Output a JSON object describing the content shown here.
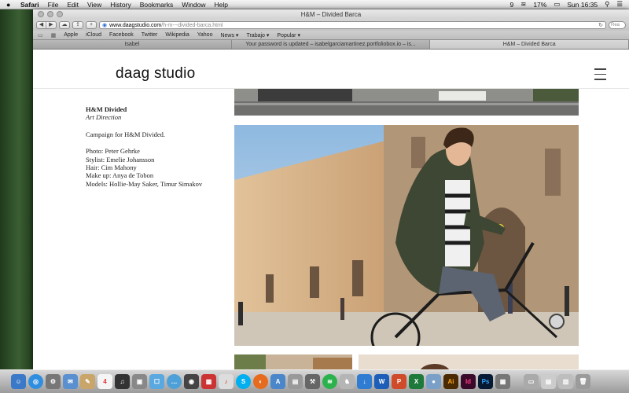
{
  "menubar": {
    "app_name": "Safari",
    "items": [
      "File",
      "Edit",
      "View",
      "History",
      "Bookmarks",
      "Window",
      "Help"
    ],
    "status": {
      "battery": "17%",
      "clock": "Sun 16:35",
      "badge": "9"
    }
  },
  "window": {
    "title": "H&M – Divided Barca",
    "address": {
      "domain": "www.daagstudio.com",
      "path": "/h-m---divided-barca.html"
    },
    "search_placeholder": "Rea",
    "bookmarks": [
      "Apple",
      "iCloud",
      "Facebook",
      "Twitter",
      "Wikipedia",
      "Yahoo",
      "News ▾",
      "Trabajo ▾",
      "Popular ▾"
    ],
    "tabs": [
      {
        "label": "Isabel"
      },
      {
        "label": "Your password is updated – isabelgarciamartinez.portfoliobox.io – is..."
      },
      {
        "label": "H&M – Divided Barca"
      }
    ]
  },
  "site": {
    "logo": "daag studio",
    "project": {
      "title": "H&M Divided",
      "subtitle": "Art Direction",
      "description": "Campaign for H&M Divided.",
      "credits": [
        "Photo: Peter Gehrke",
        "Stylist: Emelie Johansson",
        "Hair: Cim Mahony",
        "Make up: Anya de Tobon",
        "Models: Hollie-May Saker, Timur Simakov"
      ]
    }
  },
  "dock": {
    "icons": [
      "finder",
      "safari",
      "preferences",
      "mail",
      "notes",
      "calendar",
      "skype",
      "firefox",
      "photoshop",
      "illustrator",
      "indesign",
      "trash"
    ]
  },
  "colors": {
    "accent": "#2a6fd6",
    "sky": "#9cc4e8",
    "wall": "#d9b78e",
    "jacket": "#3e4733"
  }
}
